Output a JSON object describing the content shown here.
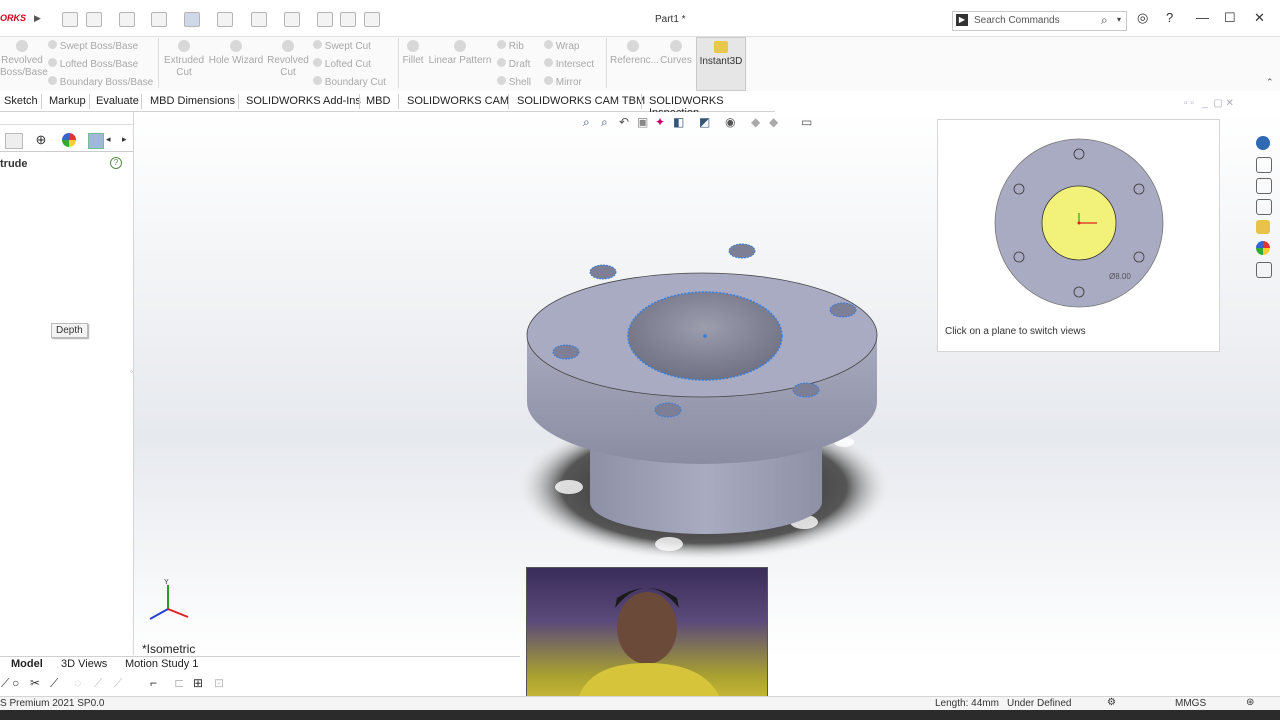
{
  "titlebar": {
    "logo": "ORKS",
    "doc_title": "Part1 *",
    "search_placeholder": "Search Commands"
  },
  "commands": {
    "revolved_boss": "Revolved Boss/Base",
    "swept_boss": "Swept Boss/Base",
    "lofted_boss": "Lofted Boss/Base",
    "boundary_boss": "Boundary Boss/Base",
    "extruded_cut": "Extruded Cut",
    "hole_wizard": "Hole Wizard",
    "revolved_cut": "Revolved Cut",
    "swept_cut": "Swept Cut",
    "lofted_cut": "Lofted Cut",
    "boundary_cut": "Boundary Cut",
    "fillet": "Fillet",
    "linear_pattern": "Linear Pattern",
    "rib": "Rib",
    "wrap": "Wrap",
    "draft": "Draft",
    "intersect": "Intersect",
    "shell": "Shell",
    "mirror": "Mirror",
    "reference": "Referenc...",
    "curves": "Curves",
    "instant3d": "Instant3D"
  },
  "tabs": [
    "Sketch",
    "Markup",
    "Evaluate",
    "MBD Dimensions",
    "SOLIDWORKS Add-Ins",
    "MBD",
    "SOLIDWORKS CAM",
    "SOLIDWORKS CAM TBM",
    "SOLIDWORKS Inspection"
  ],
  "left_panel": {
    "feature_name": "trude",
    "help": "?",
    "depth_label": "Depth"
  },
  "preview": {
    "caption": "Click on a plane to switch views",
    "dimension": "Ø8.00"
  },
  "view": {
    "orientation": "*Isometric"
  },
  "bottom_tabs": [
    "Model",
    "3D Views",
    "Motion Study 1"
  ],
  "statusbar": {
    "product": "S Premium 2021 SP0.0",
    "length": "Length: 44mm",
    "state": "Under Defined",
    "units": "MMGS"
  },
  "colors": {
    "accent": "#d0021b",
    "part_face": "#a9abc3",
    "selected_edge": "#3a7ed8",
    "sketch_fill": "#f2f27a"
  }
}
